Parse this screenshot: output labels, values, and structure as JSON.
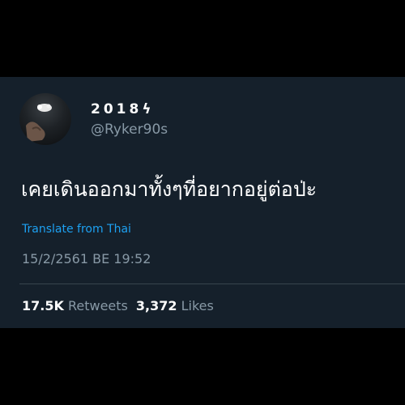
{
  "tweet": {
    "author": {
      "display_name": "2018ϟ",
      "handle": "@Ryker90s"
    },
    "text": "เคยเดินออกมาทั้งๆที่อยากอยู่ต่อป่ะ",
    "translate_label": "Translate from Thai",
    "timestamp": "15/2/2561 BE 19:52",
    "stats": {
      "retweets_count": "17.5K",
      "retweets_label": "Retweets",
      "likes_count": "3,372",
      "likes_label": "Likes"
    }
  },
  "colors": {
    "background": "#15202b",
    "outer": "#000000",
    "text": "#ffffff",
    "secondary": "#8899a6",
    "link": "#1da1f2"
  }
}
